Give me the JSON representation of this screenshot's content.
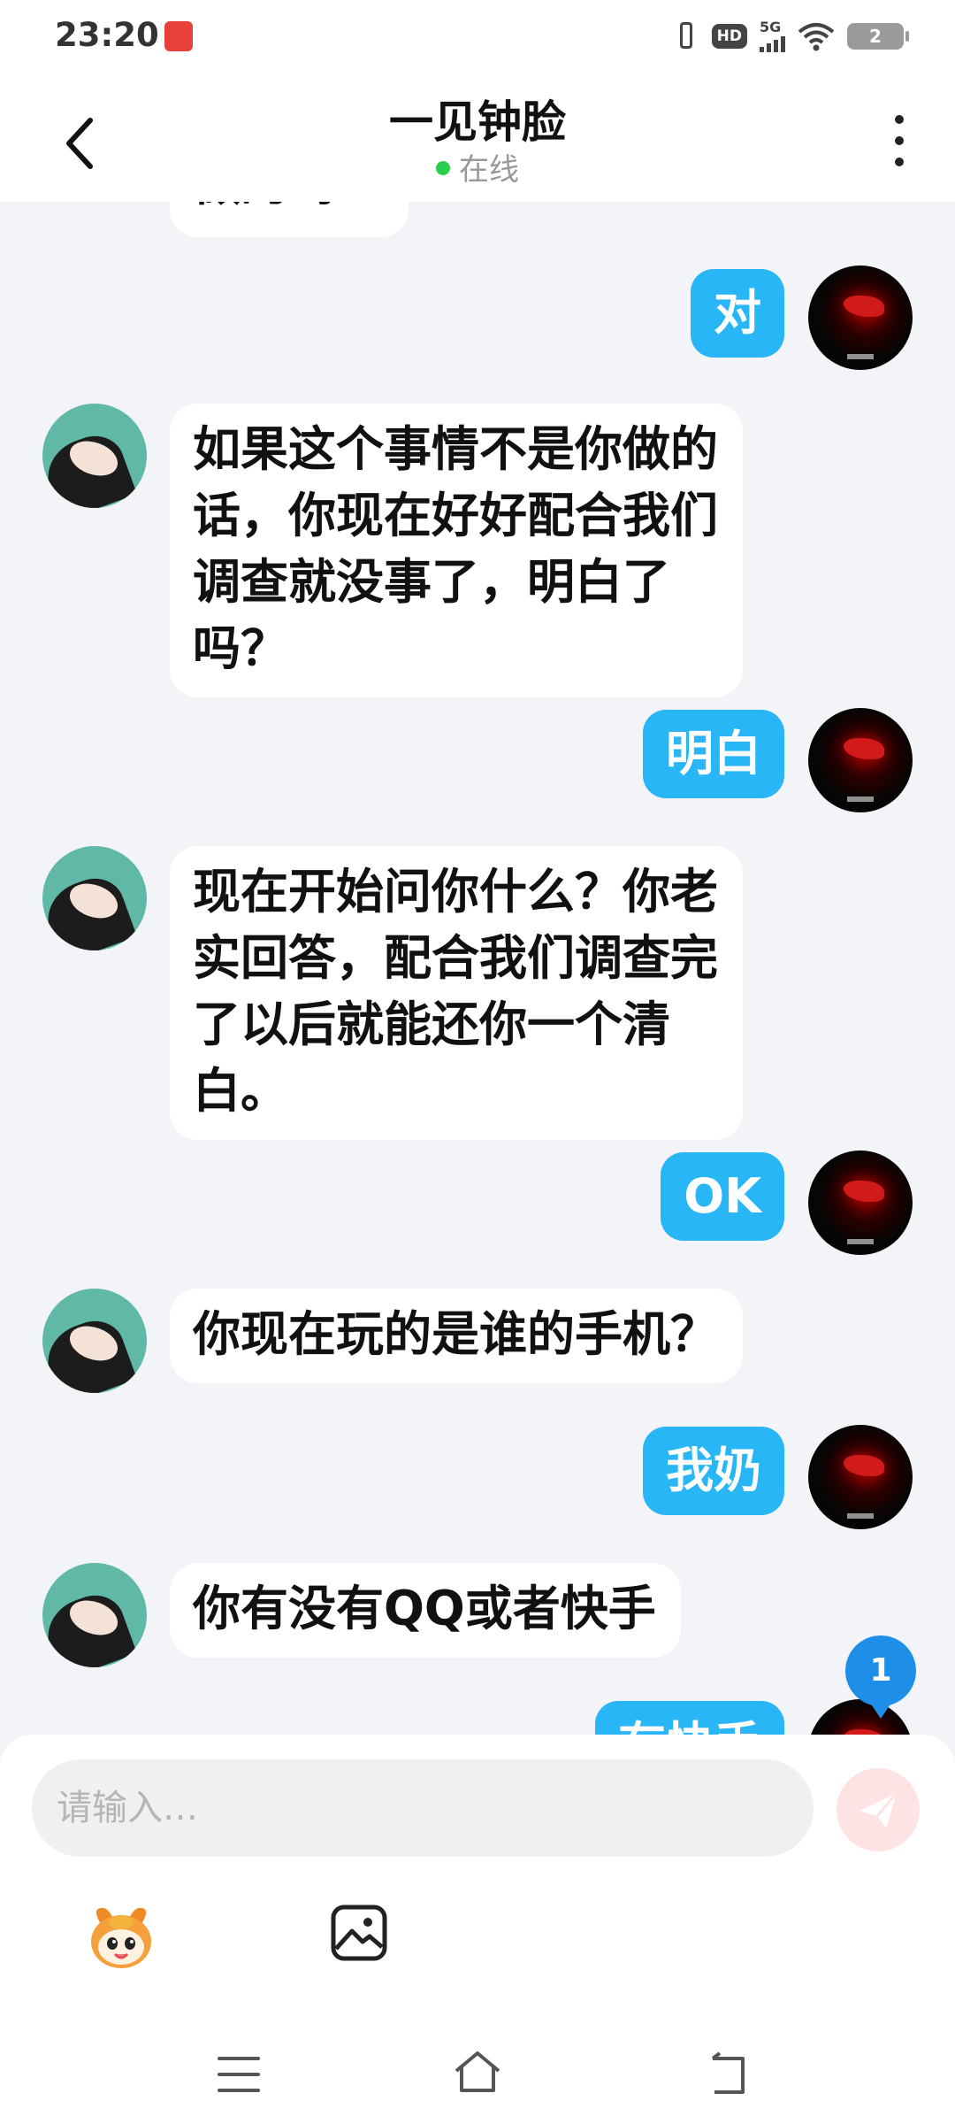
{
  "status_bar": {
    "time": "23:20",
    "network": "5G",
    "hd": "HD",
    "battery": "2",
    "icons": [
      "vibrate-icon",
      "hd-icon",
      "signal-icon",
      "wifi-icon",
      "battery-icon"
    ]
  },
  "header": {
    "title": "一见钟脸",
    "status": "在线",
    "back_icon": "chevron-left-icon",
    "more_icon": "more-vertical-icon"
  },
  "messages": [
    {
      "sender": "other",
      "text": "做的吗？"
    },
    {
      "sender": "me",
      "text": "对"
    },
    {
      "sender": "other",
      "lines": [
        "如果这个事情不是你做的",
        "话，你现在好好配合我们",
        "调查就没事了，明白了",
        "吗？"
      ]
    },
    {
      "sender": "me",
      "text": "明白"
    },
    {
      "sender": "other",
      "lines": [
        "现在开始问你什么？你老",
        "实回答，配合我们调查完",
        "了以后就能还你一个清",
        "白。"
      ]
    },
    {
      "sender": "me",
      "text": "OK"
    },
    {
      "sender": "other",
      "text": "你现在玩的是谁的手机？"
    },
    {
      "sender": "me",
      "text": "我奶"
    },
    {
      "sender": "other",
      "text": "你有没有QQ或者快手"
    },
    {
      "sender": "me",
      "text": "有快手"
    }
  ],
  "unread_badge": "1",
  "composer": {
    "placeholder": "请输入…",
    "send_icon": "send-icon",
    "tools": [
      "emoji-mascot-icon",
      "image-icon"
    ]
  },
  "colors": {
    "my_bubble": "#29b6f6",
    "other_bubble": "#ffffff",
    "background": "#f2f4f7",
    "online_dot": "#2bcf50",
    "badge": "#1e8fe8"
  }
}
